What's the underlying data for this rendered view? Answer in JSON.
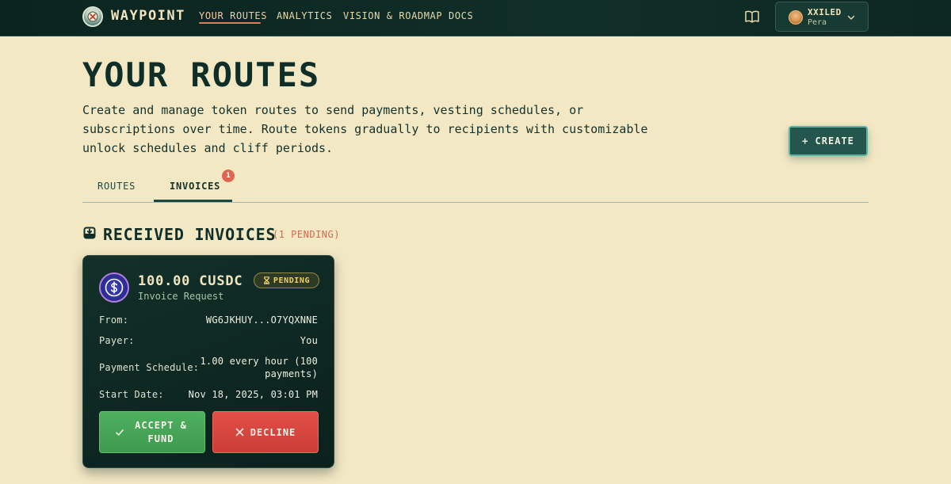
{
  "app": {
    "brand": "WAYPOINT"
  },
  "nav": {
    "links": [
      {
        "label": "YOUR ROUTES",
        "active": true
      },
      {
        "label": "ANALYTICS"
      },
      {
        "label": "VISION & ROADMAP"
      },
      {
        "label": "DOCS"
      }
    ],
    "docs_icon": "book-icon"
  },
  "user": {
    "name": "XXILED",
    "wallet": "Pera"
  },
  "header": {
    "title": "YOUR ROUTES",
    "description": "Create and manage token routes to send payments, vesting schedules, or subscriptions over time. Route tokens gradually to recipients with customizable unlock schedules and cliff periods.",
    "create_label": "+ CREATE"
  },
  "tabs": [
    {
      "label": "ROUTES",
      "active": false
    },
    {
      "label": "INVOICES",
      "active": true,
      "badge": "1"
    }
  ],
  "section": {
    "title": "RECEIVED INVOICES",
    "count": "(1 PENDING)",
    "icon": "inbox-icon"
  },
  "invoice": {
    "amount": "100.00 CUSDC",
    "type": "Invoice Request",
    "status": "PENDING",
    "details": [
      {
        "label": "From:",
        "value": "WG6JKHUY...O7YQXNNE"
      },
      {
        "label": "Payer:",
        "value": "You"
      },
      {
        "label": "Payment Schedule:",
        "value": "1.00 every hour (100 payments)"
      },
      {
        "label": "Start Date:",
        "value": "Nov 18, 2025, 03:01 PM"
      }
    ],
    "accept_label": "ACCEPT & FUND",
    "decline_label": "DECLINE"
  },
  "colors": {
    "background": "#f3e8c4",
    "navbar": "#0b241f",
    "accent": "#e07a5f",
    "primary": "#24564d",
    "card": "#0e2722",
    "pending": "#f0cf6a",
    "accept": "#4fb060",
    "decline": "#e05048"
  }
}
